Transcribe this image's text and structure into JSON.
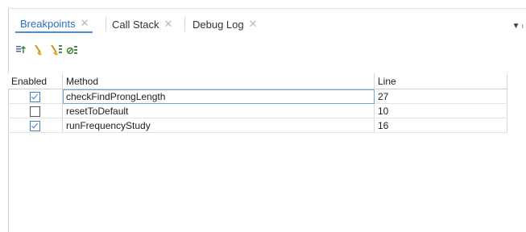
{
  "tabs": [
    {
      "label": "Breakpoints",
      "active": true
    },
    {
      "label": "Call Stack",
      "active": false
    },
    {
      "label": "Debug Log",
      "active": false
    }
  ],
  "menu_icon": "dropdown-arrow-icon",
  "toolbar_icons": [
    "step-into-icon",
    "clear-icon",
    "clear-all-icon",
    "disable-icon"
  ],
  "table": {
    "headers": {
      "enabled": "Enabled",
      "method": "Method",
      "line": "Line"
    },
    "rows": [
      {
        "enabled": true,
        "method": "checkFindProngLength",
        "line": "27",
        "selected": true
      },
      {
        "enabled": false,
        "method": "resetToDefault",
        "line": "10",
        "selected": false
      },
      {
        "enabled": true,
        "method": "runFrequencyStudy",
        "line": "16",
        "selected": false
      }
    ]
  },
  "colors": {
    "accent": "#2a6fc0",
    "checkbox": "#3c7fd0"
  }
}
